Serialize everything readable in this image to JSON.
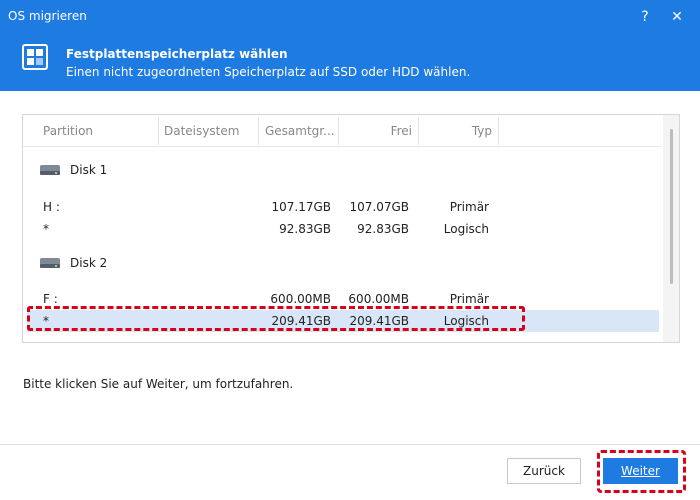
{
  "window": {
    "title": "OS migrieren",
    "help_glyph": "?",
    "close_glyph": "✕",
    "accent_color": "#1e7be2"
  },
  "header": {
    "icon": "disk-grid-icon",
    "title": "Festplattenspeicherplatz wählen",
    "subtitle": "Einen nicht zugeordneten Speicherplatz auf SSD oder HDD wählen."
  },
  "table": {
    "columns": [
      "Partition",
      "Dateisystem",
      "Gesamtgr...",
      "Frei",
      "Typ"
    ],
    "disks": [
      {
        "label": "Disk 1",
        "partitions": [
          {
            "partition": "H :",
            "filesystem": "",
            "total": "107.17GB",
            "free": "107.07GB",
            "type": "Primär"
          },
          {
            "partition": "*",
            "filesystem": "",
            "total": "92.83GB",
            "free": "92.83GB",
            "type": "Logisch"
          }
        ]
      },
      {
        "label": "Disk 2",
        "partitions": [
          {
            "partition": "F :",
            "filesystem": "",
            "total": "600.00MB",
            "free": "600.00MB",
            "type": "Primär"
          },
          {
            "partition": "*",
            "filesystem": "",
            "total": "209.41GB",
            "free": "209.41GB",
            "type": "Logisch",
            "selected": true
          }
        ]
      }
    ]
  },
  "instruction": "Bitte klicken Sie auf Weiter, um fortzufahren.",
  "buttons": {
    "back_label": "Zurück",
    "next_label": "Weiter"
  },
  "highlight_color": "#d9001b"
}
